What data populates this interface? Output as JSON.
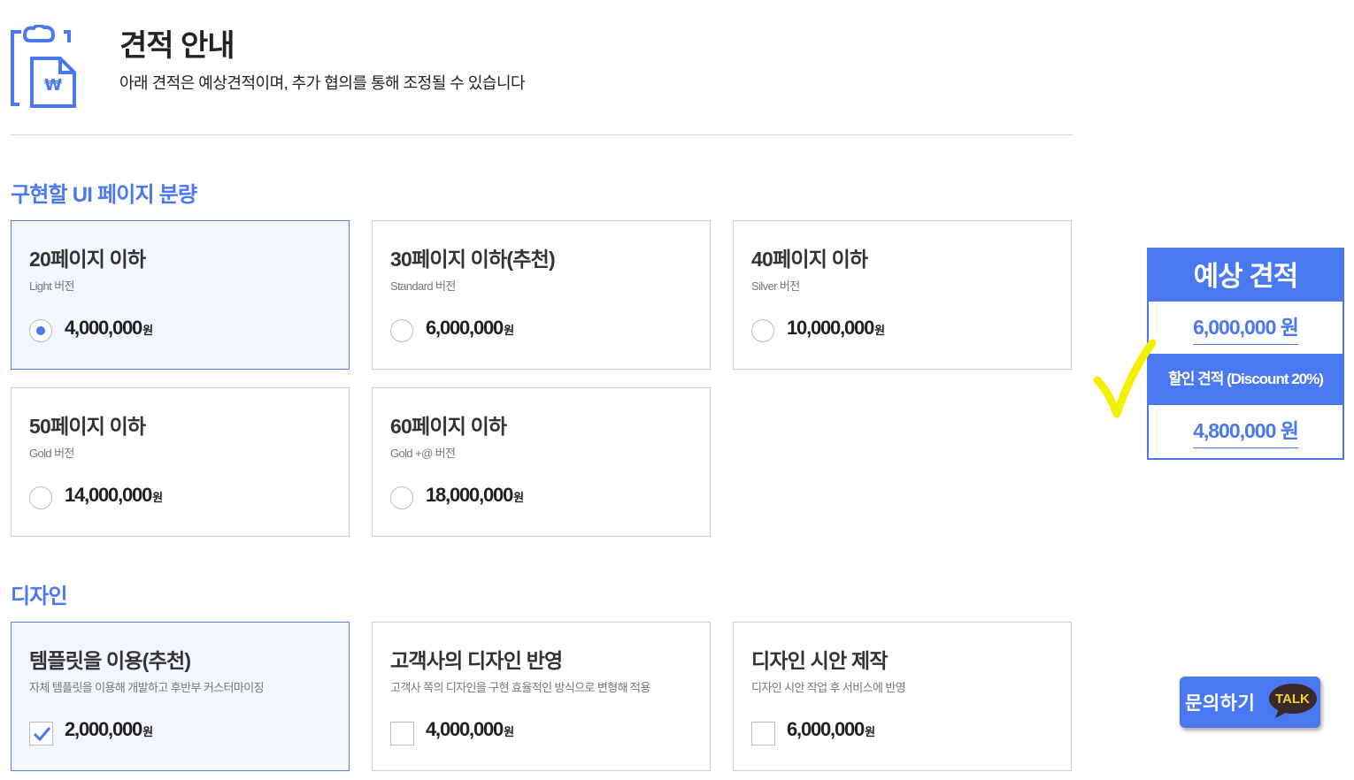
{
  "header": {
    "title": "견적 안내",
    "subtitle": "아래 견적은 예상견적이며, 추가 협의를 통해 조정될 수 있습니다",
    "icon": "quote-document-icon",
    "icon_glyph": "₩"
  },
  "sections": {
    "pages": {
      "title": "구현할 UI 페이지 분량",
      "options": [
        {
          "title": "20페이지 이하",
          "sub": "Light 버전",
          "price": "4,000,000",
          "unit": "원",
          "selected": true
        },
        {
          "title": "30페이지 이하(추천)",
          "sub": "Standard 버전",
          "price": "6,000,000",
          "unit": "원",
          "selected": false
        },
        {
          "title": "40페이지 이하",
          "sub": "Silver 버전",
          "price": "10,000,000",
          "unit": "원",
          "selected": false
        },
        {
          "title": "50페이지 이하",
          "sub": "Gold 버전",
          "price": "14,000,000",
          "unit": "원",
          "selected": false
        },
        {
          "title": "60페이지 이하",
          "sub": "Gold +@ 버전",
          "price": "18,000,000",
          "unit": "원",
          "selected": false
        }
      ]
    },
    "design": {
      "title": "디자인",
      "options": [
        {
          "title": "템플릿을 이용(추천)",
          "sub": "자체 템플릿을 이용해 개발하고 후반부 커스터마이징",
          "price": "2,000,000",
          "unit": "원",
          "checked": true
        },
        {
          "title": "고객사의 디자인 반영",
          "sub": "고객사 쪽의 디자인을 구현 효율적인 방식으로 변형해 적용",
          "price": "4,000,000",
          "unit": "원",
          "checked": false
        },
        {
          "title": "디자인 시안 제작",
          "sub": "디자인 시안 작업 후 서비스에 반영",
          "price": "6,000,000",
          "unit": "원",
          "checked": false
        }
      ]
    }
  },
  "estimate": {
    "title": "예상 견적",
    "amount": "6,000,000 원",
    "discount_label": "할인 견적 (Discount 20%)",
    "discount_amount": "4,800,000 원"
  },
  "talk": {
    "label": "문의하기",
    "badge": "TALK"
  },
  "colors": {
    "accent": "#4a78f0",
    "highlight": "#f5ef00",
    "talk_bubble": "#3a2929",
    "talk_text": "#f7d21e"
  }
}
